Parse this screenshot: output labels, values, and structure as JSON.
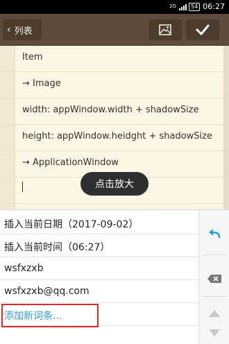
{
  "status_bar": {
    "network": "2G",
    "battery": "54",
    "clock": "06:27"
  },
  "toolbar": {
    "back_label": "列表",
    "icons": {
      "back": "chevron-left-icon",
      "image": "image-icon",
      "confirm": "check-icon"
    }
  },
  "editor": {
    "lines": [
      "Item",
      "→ Image",
      "width: appWindow.width + shadowSize",
      "height: appWindow.heidght + shadowSize",
      "→ ApplicationWindow",
      ""
    ]
  },
  "toast": {
    "text": "点击放大"
  },
  "suggestions": {
    "items": [
      "插入当前日期（2017-09-02）",
      "插入当前时间（06:27）",
      "wsfxzxb",
      "wsfxzxb@qq.com"
    ],
    "add_entry": "添加新词条…",
    "side_icons": {
      "undo": "undo-icon",
      "delete": "backspace-icon",
      "up": "arrow-up-icon",
      "down": "arrow-down-icon"
    }
  },
  "colors": {
    "toolbar": "#5d4b3e",
    "editor_bg": "#fbf5e6",
    "accent": "#2e9fd4",
    "highlight_box": "#e0272a"
  }
}
